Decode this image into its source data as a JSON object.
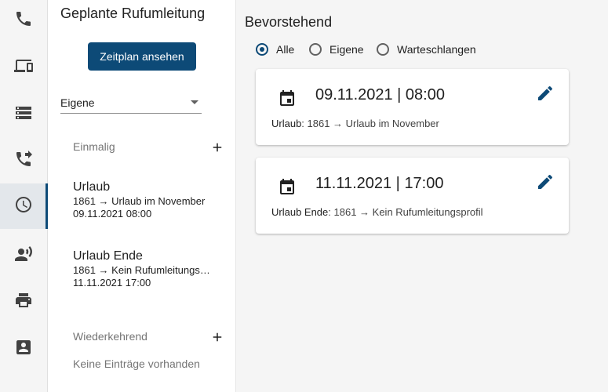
{
  "nav": {
    "items": [
      {
        "icon": "phone-icon",
        "active": false
      },
      {
        "icon": "devices-icon",
        "active": false
      },
      {
        "icon": "storage-icon",
        "active": false
      },
      {
        "icon": "phone-forward-icon",
        "active": false
      },
      {
        "icon": "clock-icon",
        "active": true
      },
      {
        "icon": "record-voice-icon",
        "active": false
      },
      {
        "icon": "printer-icon",
        "active": false
      },
      {
        "icon": "contact-card-icon",
        "active": false
      }
    ],
    "accent_color": "#0d4a77"
  },
  "panel": {
    "title": "Geplante Rufumleitung",
    "schedule_button": "Zeitplan ansehen",
    "filter_select": {
      "value": "Eigene"
    },
    "once_section": {
      "label": "Einmalig",
      "entries": [
        {
          "title": "Urlaub",
          "line1": "1861 → Urlaub im November",
          "line2": "09.11.2021 08:00"
        },
        {
          "title": "Urlaub Ende",
          "line1": "1861 → Kein Rufumleitungsprofil",
          "line2": "11.11.2021 17:00"
        }
      ]
    },
    "recurring_section": {
      "label": "Wiederkehrend",
      "empty_text": "Keine Einträge vorhanden"
    }
  },
  "main": {
    "title": "Bevorstehend",
    "filter_options": [
      {
        "label": "Alle",
        "checked": true
      },
      {
        "label": "Eigene",
        "checked": false
      },
      {
        "label": "Warteschlangen",
        "checked": false
      }
    ],
    "cards": [
      {
        "datetime": "09.11.2021 | 08:00",
        "name": "Urlaub",
        "detail": ": 1861 → Urlaub im November"
      },
      {
        "datetime": "11.11.2021 | 17:00",
        "name": "Urlaub Ende",
        "detail": ": 1861 → Kein Rufumleitungsprofil"
      }
    ]
  }
}
